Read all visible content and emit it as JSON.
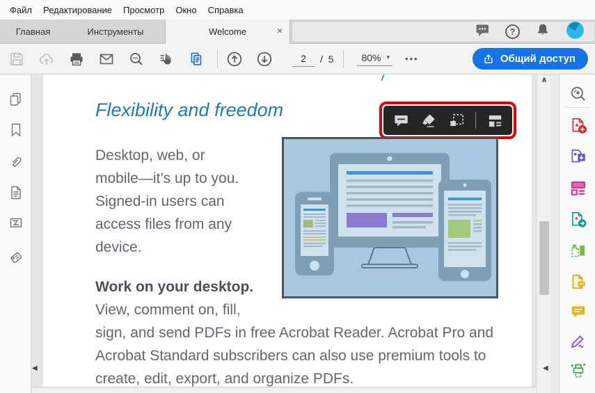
{
  "menu": {
    "items": [
      "Файл",
      "Редактирование",
      "Просмотр",
      "Окно",
      "Справка"
    ]
  },
  "tabs": {
    "home": "Главная",
    "tools": "Инструменты",
    "doc": "Welcome"
  },
  "toolbar": {
    "page_current": "2",
    "page_divider": "/",
    "page_total": "5",
    "zoom_value": "80%",
    "share_label": "Общий доступ"
  },
  "glyphs": {
    "close": "×",
    "caret": "▾",
    "more": "•••",
    "help": "?",
    "scroll_up": "∧",
    "scroll_left": "◀",
    "panel_collapse": "◀",
    "fragment": "/"
  },
  "doc": {
    "heading": "Flexibility and freedom",
    "para1_lines": [
      "Desktop, web, or",
      "mobile—it’s up to you.",
      "Signed-in users can",
      "access files from any",
      "device."
    ],
    "para2_bold": "Work on your desktop.",
    "para2_lines": [
      "View, comment on, fill,",
      "sign, and send PDFs in free Acrobat Reader. Acrobat Pro and",
      "Acrobat Standard subscribers can also use premium tools to",
      "create, edit, export, and organize PDFs."
    ]
  },
  "colors": {
    "accent_blue": "#1473e6",
    "heading_blue": "#2179bd",
    "annotation_red": "#dc0404",
    "body_text": "#5e6871",
    "illustration_bg": "#a9c7de"
  },
  "icon_names": {
    "toolbar": [
      "save",
      "cloud-upload",
      "print",
      "email",
      "search-zoom",
      "selection-tool",
      "page-copy",
      "page-up",
      "page-down",
      "share"
    ],
    "titlebar": [
      "feedback",
      "help",
      "notifications",
      "avatar"
    ],
    "left_panel": [
      "page-thumbnails",
      "bookmarks",
      "attachments",
      "page",
      "layers",
      "tags"
    ],
    "right_panel": [
      "search-tools",
      "create-pdf",
      "export-pdf",
      "edit-pdf",
      "send-pdf",
      "combine-files",
      "comment-document",
      "comments",
      "fill-sign",
      "enhance-scans"
    ],
    "hud": [
      "comment",
      "highlight",
      "snapshot",
      "layout"
    ]
  }
}
